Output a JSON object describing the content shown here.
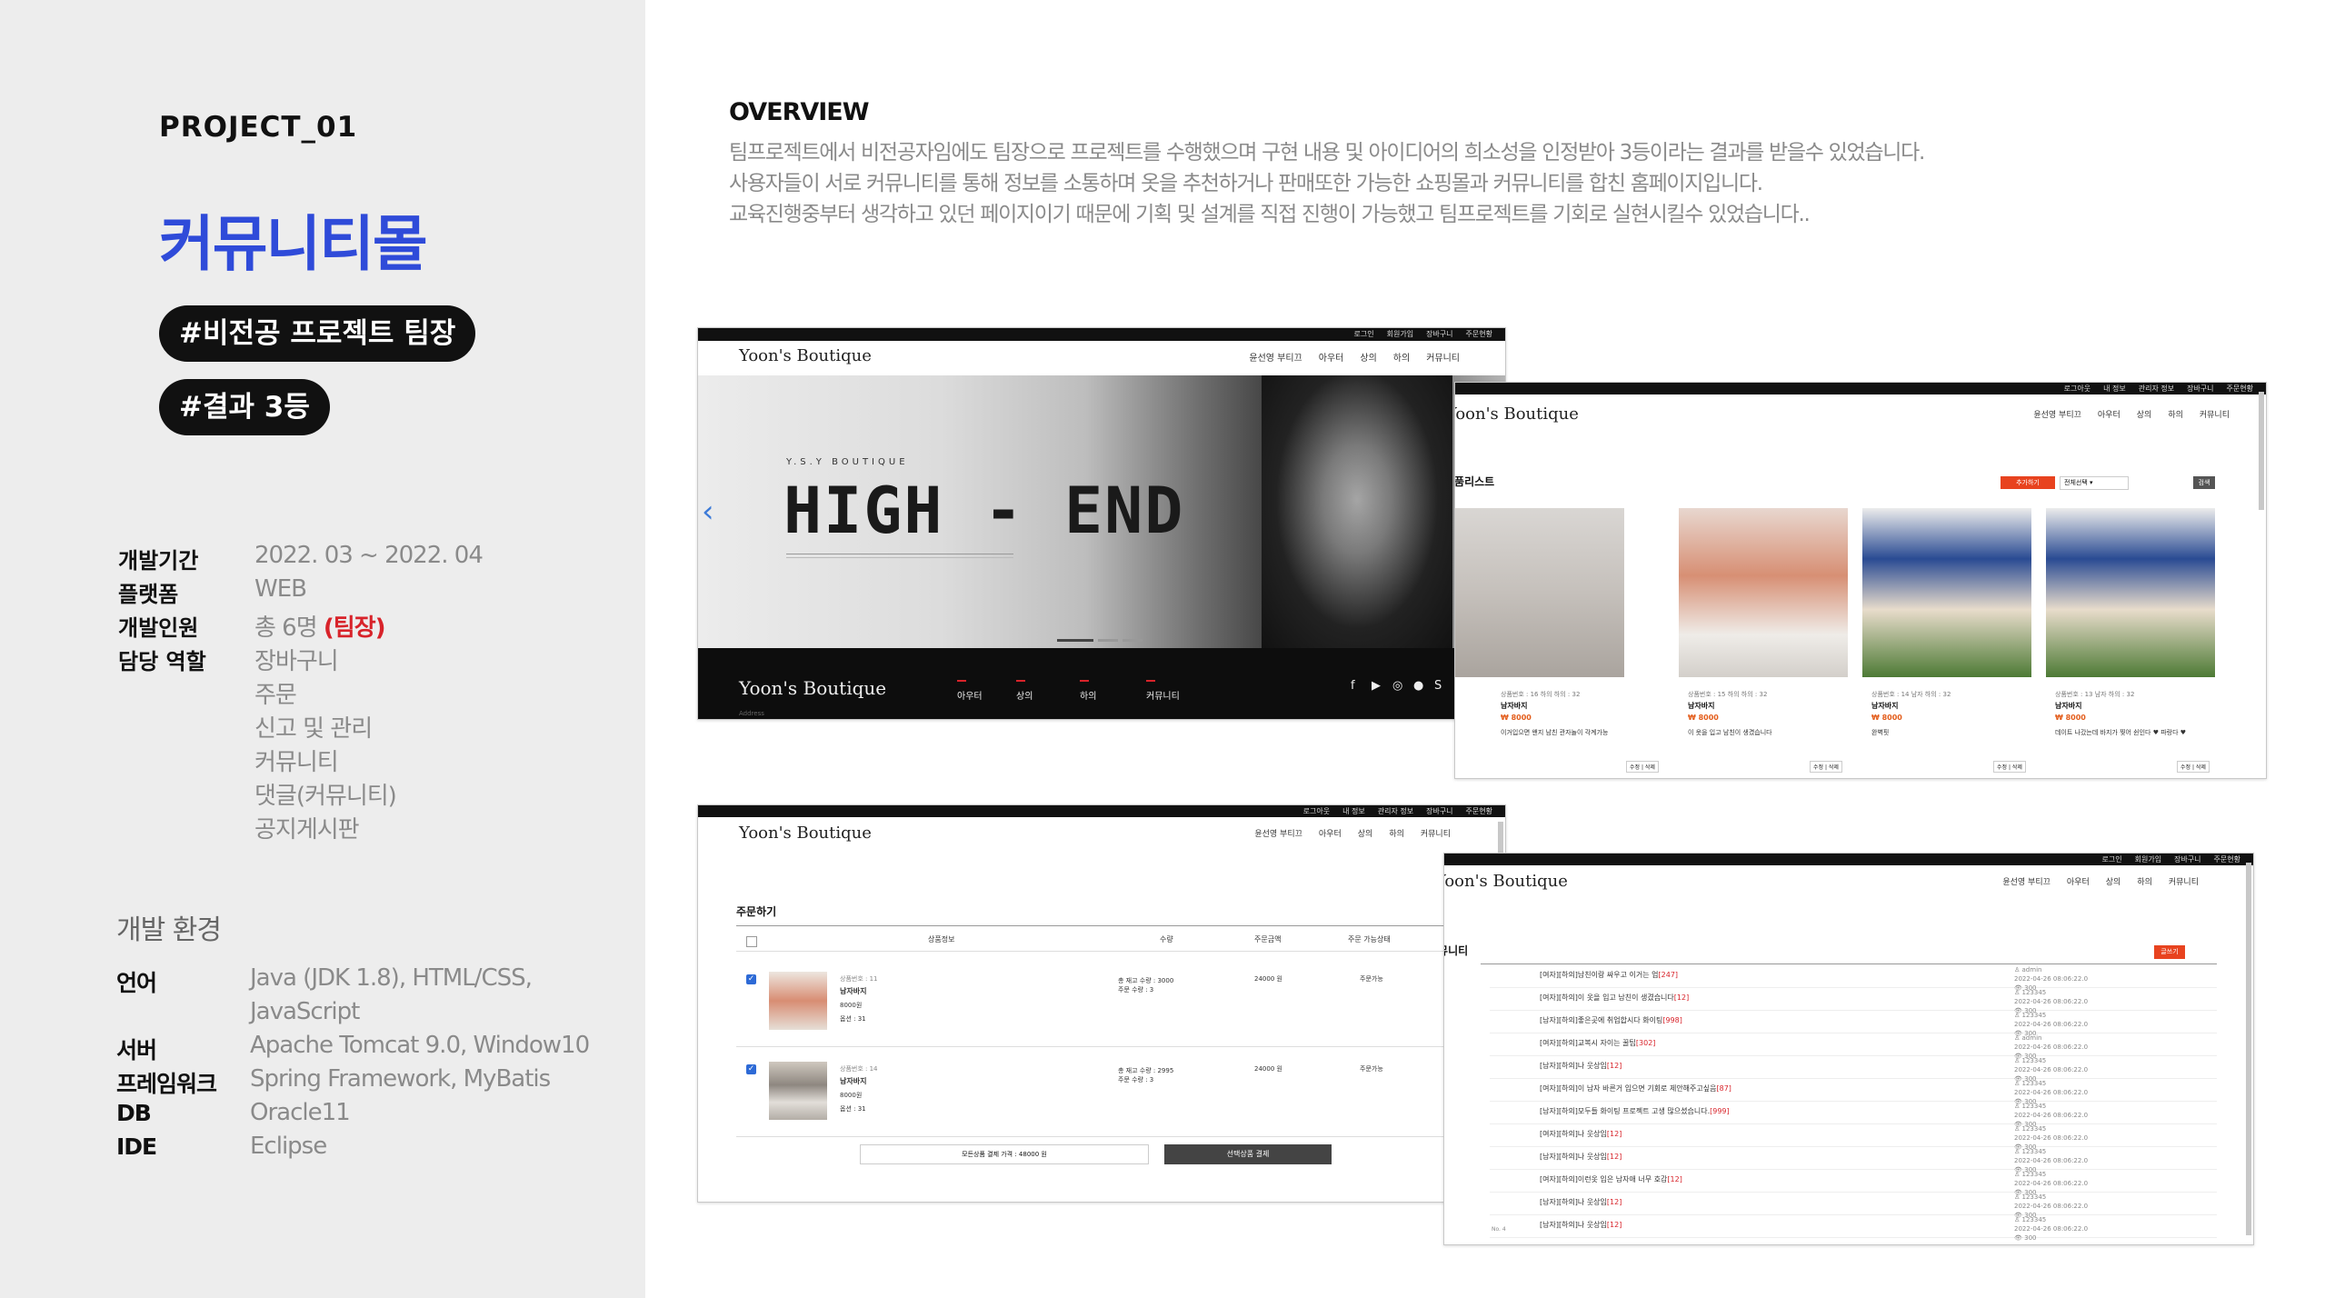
{
  "project": {
    "label": "PROJECT_01",
    "title": "커뮤니티몰",
    "tags": [
      "#비전공 프로젝트 팀장",
      "#결과 3등"
    ]
  },
  "info": [
    {
      "label": "개발기간",
      "value": "2022. 03 ~ 2022. 04"
    },
    {
      "label": "플랫폼",
      "value": "WEB"
    },
    {
      "label": "개발인원",
      "value": "총 6명",
      "highlight": "(팀장)"
    },
    {
      "label": "담당 역할",
      "value": "장바구니"
    }
  ],
  "roles_extra": [
    "주문",
    "신고 및 관리",
    "커뮤니티",
    "댓글(커뮤니티)",
    "공지게시판"
  ],
  "env": {
    "title": "개발 환경",
    "rows": [
      {
        "label": "언어",
        "value": "Java (JDK 1.8), HTML/CSS, JavaScript"
      },
      {
        "label": "서버",
        "value": "Apache Tomcat 9.0, Window10"
      },
      {
        "label": "프레임워크",
        "value": "Spring Framework, MyBatis"
      },
      {
        "label": "DB",
        "value": "Oracle11"
      },
      {
        "label": "IDE",
        "value": "Eclipse"
      }
    ]
  },
  "overview": {
    "title": "OVERVIEW",
    "lines": [
      "팀프로젝트에서 비전공자임에도 팀장으로 프로젝트를 수행했으며 구현 내용 및 아이디어의 희소성을 인정받아 3등이라는 결과를 받을수 있었습니다.",
      "사용자들이 서로 커뮤니티를 통해 정보를 소통하며 옷을 추천하거나 판매또한 가능한 쇼핑몰과 커뮤니티를 합친 홈페이지입니다.",
      "교육진행중부터 생각하고 있던 페이지이기 때문에 기획 및 설계를 직접 진행이 가능했고 팀프로젝트를 기회로 실현시킬수 있었습니다.."
    ]
  },
  "site": {
    "brand": "Yoon's Boutique",
    "topbar": [
      "로그인",
      "회원가입",
      "장바구니",
      "주문현황"
    ],
    "topbar_member": [
      "로그아웃",
      "내 정보",
      "관리자 정보",
      "장바구니",
      "주문현황"
    ],
    "nav": [
      "윤선영 부티끄",
      "아우터",
      "상의",
      "하의",
      "커뮤니티"
    ],
    "hero_sub": "Y.S.Y BOUTIQUE",
    "hero_title": "HIGH - END",
    "footer_nav": [
      "아우터",
      "상의",
      "하의",
      "커뮤니티"
    ],
    "footer_address": "Address",
    "social": [
      "f",
      "▶",
      "◎",
      "●",
      "S"
    ],
    "arrow_left": "‹",
    "arrow_right": "›"
  },
  "product_list": {
    "title": "상품리스트",
    "add_button": "추가하기",
    "select": "전체선택",
    "search_button": "검색",
    "items": [
      {
        "meta": "상품번호 : 16   하의 하의 : 32",
        "name": "남자바지",
        "price": "₩ 8000",
        "desc": "이거입으면 왠지 남친 관자놀이 각계가능"
      },
      {
        "meta": "상품번호 : 15   하의 하의 : 32",
        "name": "남자바지",
        "price": "₩ 8000",
        "desc": "이 옷을 입고 남친이 생겼습니다"
      },
      {
        "meta": "상품번호 : 14   남자 하의 : 32",
        "name": "남자바지",
        "price": "₩ 8000",
        "desc": "완벽핏"
      },
      {
        "meta": "상품번호 : 13   남자 하의 : 32",
        "name": "남자바지",
        "price": "₩ 8000",
        "desc": "데이트 나갔는데 바지가 찢어 쉰인다 ♥ 파랑다 ♥"
      }
    ],
    "edit_buttons": "수정 | 삭제"
  },
  "order": {
    "title": "주문하기",
    "headers": [
      "상품정보",
      "수량",
      "주문금액",
      "주문 가능상태"
    ],
    "rows": [
      {
        "code": "상품번호 : 11",
        "name": "남자바지",
        "price": "8000원",
        "option": "옵션 : 31",
        "qty": "총 재고 수량 : 3000",
        "qty2": "주문 수량 : 3",
        "amount": "24000 원",
        "status": "주문가능"
      },
      {
        "code": "상품번호 : 14",
        "name": "남자바지",
        "price": "8000원",
        "option": "옵션 : 31",
        "qty": "총 재고 수량 : 2995",
        "qty2": "주문 수량 : 3",
        "amount": "24000 원",
        "status": "주문가능"
      }
    ],
    "total": "모든상품 결제 가격 : 48000 원",
    "pay_button": "선택상품 결제"
  },
  "community": {
    "title": "커뮤니티",
    "write_button": "글쓰기",
    "rows": [
      {
        "title": "[여자][하의]남친이랑 싸우고 이거는 업",
        "count": "[247]",
        "author": "admin"
      },
      {
        "title": "[여자][하의]이 옷을 입고 남친이 생겼습니다",
        "count": "[12]",
        "author": "123345"
      },
      {
        "title": "[남자][하의]좋은곳에 취업합시다 화이팅",
        "count": "[998]",
        "author": "123345"
      },
      {
        "title": "[여자][하의]교복시 자이는 꿀팁",
        "count": "[302]",
        "author": "admin"
      },
      {
        "title": "[남자][하의]나 웃상임",
        "count": "[12]",
        "author": "123345"
      },
      {
        "title": "[여자][하의]이 남자 바른거 입으면 기회로 제안해주고싶음",
        "count": "[87]",
        "author": "123345"
      },
      {
        "title": "[남자][하의]모두들 화이팅 프로젝트 고생 많으셨습니다.",
        "count": "[999]",
        "author": "123345"
      },
      {
        "title": "[여자][하의]나 웃상임",
        "count": "[12]",
        "author": "123345"
      },
      {
        "title": "[남자][하의]나 웃상임",
        "count": "[12]",
        "author": "123345"
      },
      {
        "title": "[여자][하의]이런옷 입은 남자애 너무 호감",
        "count": "[12]",
        "author": "123345"
      },
      {
        "title": "[남자][하의]나 웃상임",
        "count": "[12]",
        "author": "123345"
      },
      {
        "title": "[남자][하의]나 웃상임",
        "count": "[12]",
        "author": "123345"
      }
    ],
    "date": "2022-04-26 08:06:22.0",
    "views": "👁 300"
  },
  "colors": {
    "accent": "#2f4bd9",
    "lead": "#d8232a",
    "button": "#e8431f"
  }
}
